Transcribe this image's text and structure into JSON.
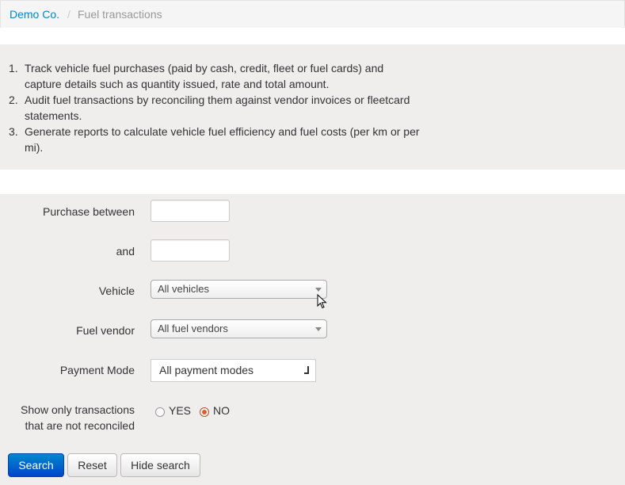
{
  "breadcrumb": {
    "home": "Demo Co.",
    "separator": "/",
    "current": "Fuel transactions"
  },
  "intro": {
    "items": [
      {
        "num": "1.",
        "line1": "Track vehicle fuel purchases (paid by cash, credit, fleet or fuel cards) and",
        "line2": "capture details such as quantity issued, rate and total amount."
      },
      {
        "num": "2.",
        "line1": "Audit fuel transactions by reconciling them against vendor invoices or fleetcard",
        "line2": "statements."
      },
      {
        "num": "3.",
        "line1": "Generate reports to calculate vehicle fuel efficiency and fuel costs (per km or per",
        "line2": "mi)."
      }
    ]
  },
  "search": {
    "purchase_between_label": "Purchase between",
    "and_label": "and",
    "date_from_value": "",
    "date_to_value": "",
    "vehicle_label": "Vehicle",
    "vehicle_selected": "All vehicles",
    "fuel_vendor_label": "Fuel vendor",
    "fuel_vendor_selected": "All fuel vendors",
    "payment_mode_label": "Payment Mode",
    "payment_mode_selected": "All payment modes",
    "unreconciled_label_line1": "Show only transactions",
    "unreconciled_label_line2": "that are not reconciled",
    "yes_label": "YES",
    "no_label": "NO",
    "selected_option": "NO"
  },
  "buttons": {
    "search": "Search",
    "reset": "Reset",
    "hide_search": "Hide search"
  },
  "colors": {
    "link": "#0088cc",
    "primary": "#0055cc",
    "panel_bg": "#f0eeed",
    "radio_on": "#e35c2c"
  }
}
